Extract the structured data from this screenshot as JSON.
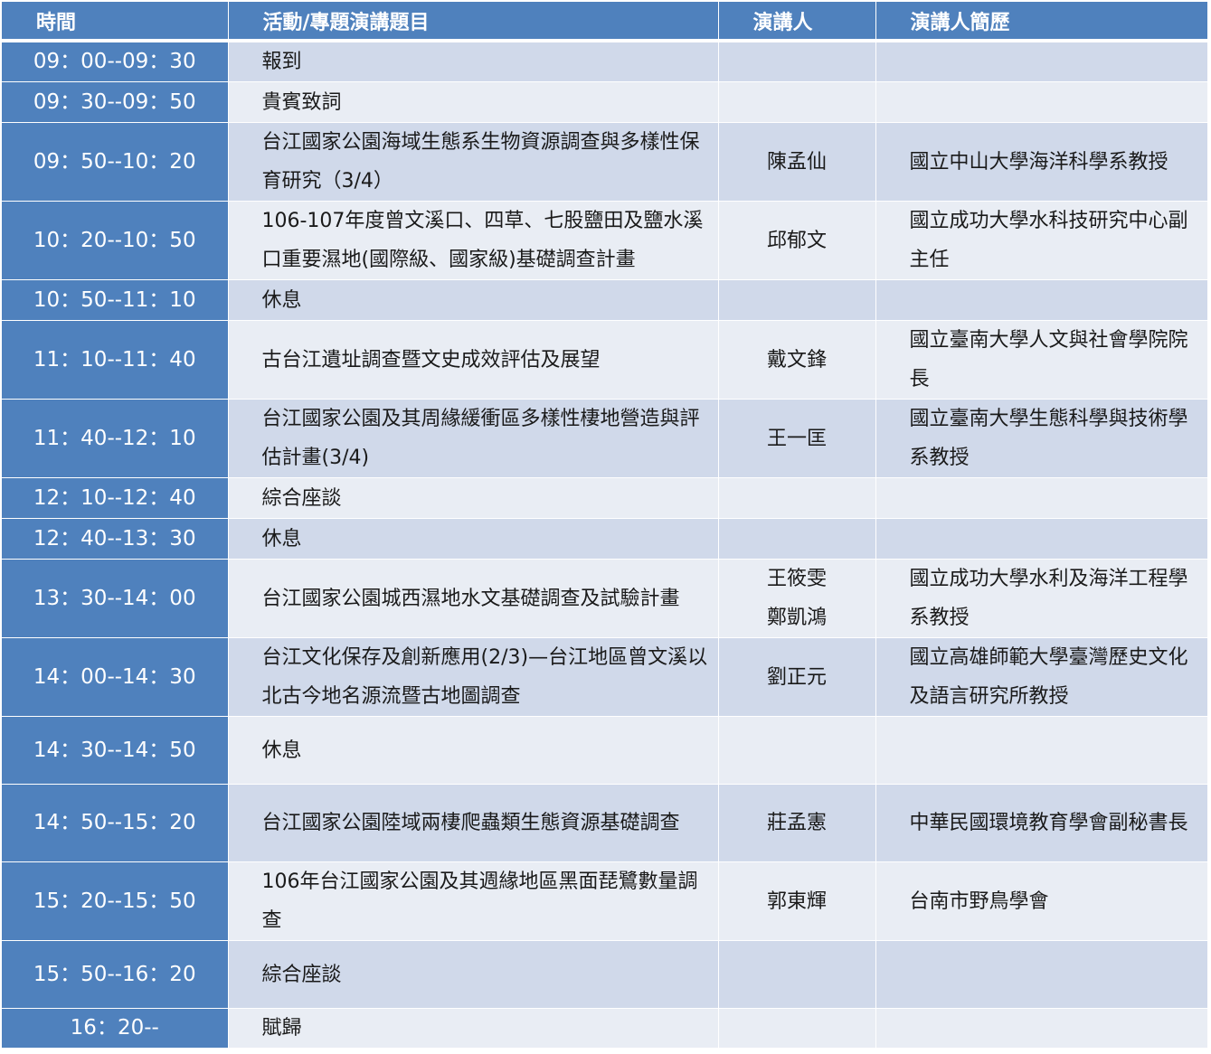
{
  "headers": {
    "time": "時間",
    "topic": "活動/專題演講題目",
    "speaker": "演講人",
    "bio": "演講人簡歷"
  },
  "rows": [
    {
      "time": "09：00--09：30",
      "topic": "報到",
      "speaker": "",
      "bio": ""
    },
    {
      "time": "09：30--09：50",
      "topic": "貴賓致詞",
      "speaker": "",
      "bio": ""
    },
    {
      "time": "09：50--10：20",
      "topic": "台江國家公園海域生態系生物資源調查與多樣性保育研究（3/4）",
      "speaker": "陳孟仙",
      "bio": "國立中山大學海洋科學系教授"
    },
    {
      "time": "10：20--10：50",
      "topic": "106-107年度曾文溪口、四草、七股鹽田及鹽水溪口重要濕地(國際級、國家級)基礎調查計畫",
      "speaker": "邱郁文",
      "bio": "國立成功大學水科技研究中心副主任"
    },
    {
      "time": "10：50--11：10",
      "topic": "休息",
      "speaker": "",
      "bio": ""
    },
    {
      "time": "11：10--11：40",
      "topic": "古台江遺址調查暨文史成效評估及展望",
      "speaker": "戴文鋒",
      "bio": "國立臺南大學人文與社會學院院長"
    },
    {
      "time": "11：40--12：10",
      "topic": "台江國家公園及其周緣緩衝區多樣性棲地營造與評估計畫(3/4)",
      "speaker": "王一匡",
      "bio": "國立臺南大學生態科學與技術學系教授"
    },
    {
      "time": "12：10--12：40",
      "topic": "綜合座談",
      "speaker": "",
      "bio": ""
    },
    {
      "time": "12：40--13：30",
      "topic": "休息",
      "speaker": "",
      "bio": ""
    },
    {
      "time": "13：30--14：00",
      "topic": "台江國家公園城西濕地水文基礎調查及試驗計畫",
      "speaker": "王筱雯\n鄭凱鴻",
      "bio": "國立成功大學水利及海洋工程學系教授"
    },
    {
      "time": "14：00--14：30",
      "topic": "台江文化保存及創新應用(2/3)—台江地區曾文溪以北古今地名源流暨古地圖調查",
      "speaker": "劉正元",
      "bio": "國立高雄師範大學臺灣歷史文化及語言研究所教授"
    },
    {
      "time": "14：30--14：50",
      "topic": "休息",
      "speaker": "",
      "bio": ""
    },
    {
      "time": "14：50--15：20",
      "topic": "台江國家公園陸域兩棲爬蟲類生態資源基礎調查",
      "speaker": "莊孟憲",
      "bio": "中華民國環境教育學會副秘書長"
    },
    {
      "time": "15：20--15：50",
      "topic": "106年台江國家公園及其週緣地區黑面琵鷺數量調查",
      "speaker": "郭東輝",
      "bio": "台南市野鳥學會"
    },
    {
      "time": "15：50--16：20",
      "topic": "綜合座談",
      "speaker": "",
      "bio": ""
    },
    {
      "time": "16：20--",
      "topic": "賦歸",
      "speaker": "",
      "bio": ""
    }
  ]
}
